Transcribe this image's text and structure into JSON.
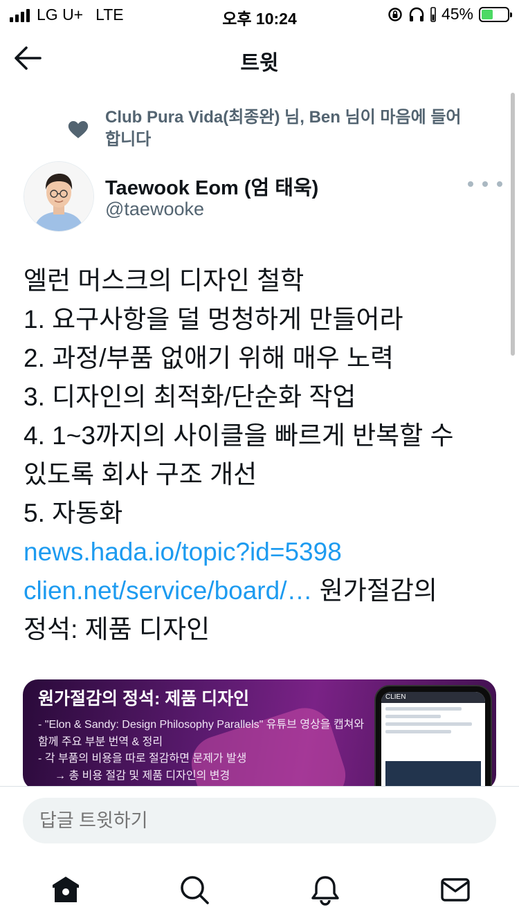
{
  "status_bar": {
    "carrier": "LG U+",
    "network": "LTE",
    "time": "오후 10:24",
    "battery": "45%",
    "battery_level": 0.45
  },
  "header": {
    "title": "트윗"
  },
  "social_context": {
    "text": "Club Pura Vida(최종완) 님, Ben 님이 마음에 들어 합니다",
    "icon": "heart-icon"
  },
  "author": {
    "name": "Taewook Eom (엄 태욱)",
    "handle": "@taewooke"
  },
  "tweet": {
    "lines": [
      "엘런 머스크의 디자인 철학",
      "1. 요구사항을 덜 멍청하게 만들어라",
      "2. 과정/부품 없애기 위해 매우 노력",
      "3. 디자인의 최적화/단순화 작업",
      "4. 1~3까지의 사이클을 빠르게 반복할 수",
      "있도록 회사 구조 개선",
      "5. 자동화"
    ],
    "link1": "news.hada.io/topic?id=5398",
    "link2": "clien.net/service/board/…",
    "link2_suffix": " 원가절감의",
    "last_line": "정석: 제품 디자인"
  },
  "card": {
    "title": "원가절감의 정석: 제품 디자인",
    "lines": [
      "- \"Elon & Sandy: Design Philosophy Parallels\" 유튜브 영상을 캡쳐와",
      "함께 주요 부분 번역 & 정리",
      "- 각 부품의 비용을 따로 절감하면 문제가 발생",
      "→ 총 비용 절감 및 제품 디자인의 변경"
    ],
    "phone_brand": "CLIEN"
  },
  "reply": {
    "placeholder": "답글 트윗하기"
  },
  "colors": {
    "link": "#1d9bf0",
    "secondary_text": "#536471",
    "primary_text": "#0f1419"
  }
}
